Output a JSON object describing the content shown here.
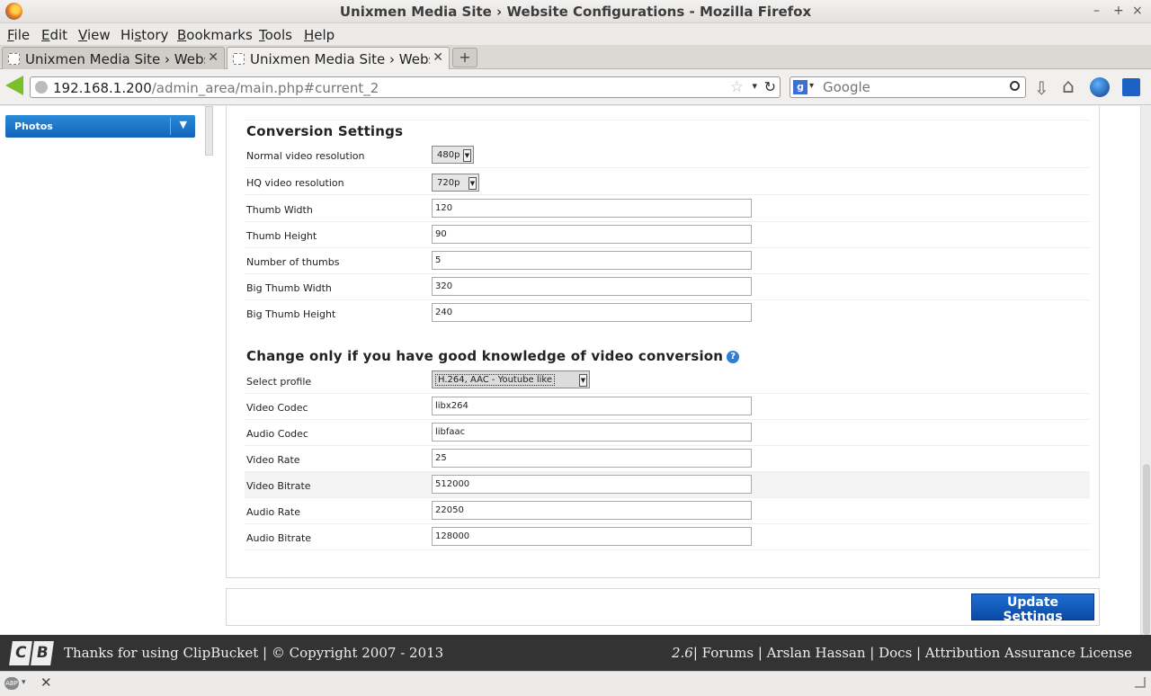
{
  "window": {
    "title": "Unixmen Media Site › Website Configurations - Mozilla Firefox",
    "min": "–",
    "max": "+",
    "close": "×"
  },
  "menu": [
    {
      "first": "F",
      "rest": "ile"
    },
    {
      "first": "E",
      "rest": "dit"
    },
    {
      "first": "V",
      "rest": "iew"
    },
    {
      "first": "Hi",
      "u": "s",
      "rest": "tory"
    },
    {
      "first": "B",
      "rest": "ookmarks"
    },
    {
      "first": "T",
      "rest": "ools"
    },
    {
      "first": "H",
      "rest": "elp"
    }
  ],
  "tabs": [
    {
      "label": "Unixmen Media Site › Websi…",
      "close": "✕"
    },
    {
      "label": "Unixmen Media Site › Websi…",
      "close": "✕"
    }
  ],
  "newtab": "+",
  "nav": {
    "url_host": "192.168.1.200",
    "url_path": "/admin_area/main.php#current_2",
    "star": "☆",
    "drop": "▾",
    "reload": "↻",
    "search_engine": "g",
    "search_drop": "▾",
    "search_placeholder": "Google",
    "download": "⇩",
    "home": "⌂"
  },
  "sidebar": {
    "photos_label": "Photos",
    "arrow": "▼"
  },
  "conversion": {
    "title": "Conversion Settings",
    "rows": [
      {
        "label": "Normal video resolution",
        "type": "select",
        "value": "480p"
      },
      {
        "label": "HQ video resolution",
        "type": "select",
        "value": "720p"
      },
      {
        "label": "Thumb Width",
        "type": "text",
        "value": "120"
      },
      {
        "label": "Thumb Height",
        "type": "text",
        "value": "90"
      },
      {
        "label": "Number of thumbs",
        "type": "text",
        "value": "5"
      },
      {
        "label": "Big Thumb Width",
        "type": "text",
        "value": "320"
      },
      {
        "label": "Big Thumb Height",
        "type": "text",
        "value": "240"
      }
    ]
  },
  "advanced": {
    "title": "Change only if you have good knowledge of video conversion",
    "help": "?",
    "rows": [
      {
        "label": "Select profile",
        "type": "select",
        "value": "H.264, AAC - Youtube like"
      },
      {
        "label": "Video Codec",
        "type": "text",
        "value": "libx264"
      },
      {
        "label": "Audio Codec",
        "type": "text",
        "value": "libfaac"
      },
      {
        "label": "Video Rate",
        "type": "text",
        "value": "25"
      },
      {
        "label": "Video Bitrate",
        "type": "text",
        "value": "512000"
      },
      {
        "label": "Audio Rate",
        "type": "text",
        "value": "22050"
      },
      {
        "label": "Audio Bitrate",
        "type": "text",
        "value": "128000"
      }
    ]
  },
  "update_button": "Update Settings",
  "footer": {
    "logo_c": "C",
    "logo_b": "B",
    "text": "Thanks for using ClipBucket | © Copyright 2007 - 2013",
    "version": "2.6",
    "links_text": "| Forums | Arslan Hassan | Docs | Attribution Assurance License"
  },
  "statusbar": {
    "abp": "ABP",
    "abp_drop": "▾",
    "close": "✕"
  }
}
